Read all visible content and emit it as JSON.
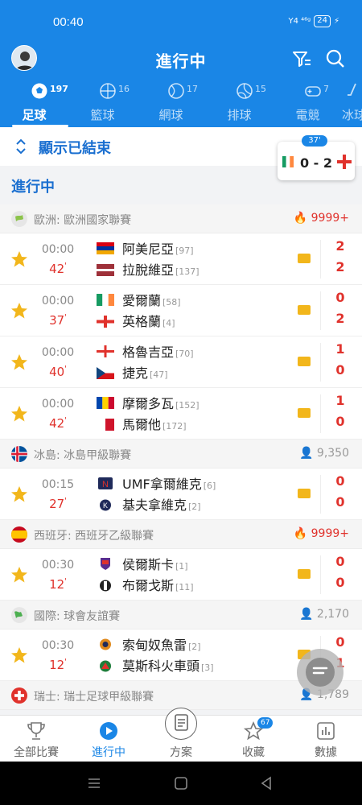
{
  "status_bar": {
    "time": "00:40",
    "signal": "Y4 ⁴⁶ᵍ",
    "battery": "24"
  },
  "header": {
    "title": "進行中"
  },
  "sport_tabs": [
    {
      "label": "足球",
      "count": "197"
    },
    {
      "label": "籃球",
      "count": "16"
    },
    {
      "label": "網球",
      "count": "17"
    },
    {
      "label": "排球",
      "count": "15"
    },
    {
      "label": "電競",
      "count": "7"
    },
    {
      "label": "冰球",
      "count": ""
    }
  ],
  "show_ended": {
    "label": "顯示已結束"
  },
  "mini_score": {
    "minute": "37'",
    "score": "0 - 2"
  },
  "section_title": "進行中",
  "leagues": [
    {
      "name": "歐洲: 歐洲國家聯賽",
      "heat": "9999+"
    },
    {
      "name": "冰島: 冰島甲級聯賽",
      "heat": "9,350"
    },
    {
      "name": "西班牙: 西班牙乙級聯賽",
      "heat": "9999+"
    },
    {
      "name": "國際: 球會友誼賽",
      "heat": "2,170"
    },
    {
      "name": "瑞士: 瑞士足球甲級聯賽",
      "heat": "1,789"
    }
  ],
  "matches": [
    {
      "kick": "00:00",
      "minute": "42",
      "home": "阿美尼亞",
      "home_rank": "[97]",
      "away": "拉脫維亞",
      "away_rank": "[137]",
      "home_score": "2",
      "away_score": "2"
    },
    {
      "kick": "00:00",
      "minute": "37",
      "home": "愛爾蘭",
      "home_rank": "[58]",
      "away": "英格蘭",
      "away_rank": "[4]",
      "home_score": "0",
      "away_score": "2"
    },
    {
      "kick": "00:00",
      "minute": "40",
      "home": "格魯吉亞",
      "home_rank": "[70]",
      "away": "捷克",
      "away_rank": "[47]",
      "home_score": "1",
      "away_score": "0"
    },
    {
      "kick": "00:00",
      "minute": "42",
      "home": "摩爾多瓦",
      "home_rank": "[152]",
      "away": "馬爾他",
      "away_rank": "[172]",
      "home_score": "1",
      "away_score": "0"
    },
    {
      "kick": "00:15",
      "minute": "27",
      "home": "UMF拿爾維克",
      "home_rank": "[6]",
      "away": "基夫拿維克",
      "away_rank": "[2]",
      "home_score": "0",
      "away_score": "0"
    },
    {
      "kick": "00:30",
      "minute": "12",
      "home": "侯爾斯卡",
      "home_rank": "[1]",
      "away": "布爾戈斯",
      "away_rank": "[11]",
      "home_score": "0",
      "away_score": "0"
    },
    {
      "kick": "00:30",
      "minute": "12",
      "home": "索甸奴魚雷",
      "home_rank": "[2]",
      "away": "莫斯科火車頭",
      "away_rank": "[3]",
      "home_score": "0",
      "away_score": "1"
    }
  ],
  "bottom_nav": [
    {
      "label": "全部比賽"
    },
    {
      "label": "進行中"
    },
    {
      "label": "方案"
    },
    {
      "label": "收藏",
      "badge": "67"
    },
    {
      "label": "數據"
    }
  ],
  "colors": {
    "primary": "#1a86e6",
    "live_red": "#e0322c",
    "star": "#f2b61b"
  }
}
